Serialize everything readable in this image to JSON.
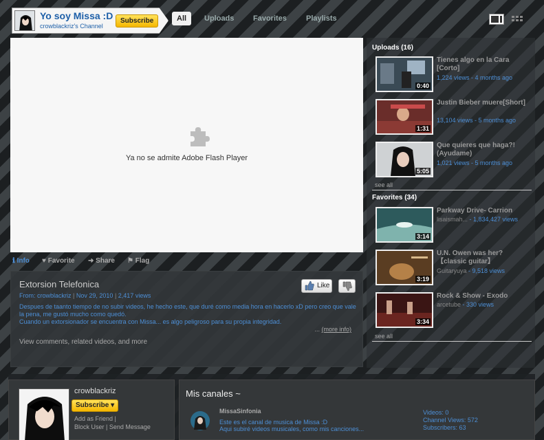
{
  "channel": {
    "title": "Yo soy Missa :D",
    "subtitle": "crowblackriz's Channel",
    "subscribe_label": "Subscribe"
  },
  "tabs": [
    {
      "label": "All",
      "active": true
    },
    {
      "label": "Uploads"
    },
    {
      "label": "Favorites"
    },
    {
      "label": "Playlists"
    }
  ],
  "player": {
    "message": "Ya no se admite Adobe Flash Player",
    "icon": "puzzle-icon"
  },
  "actions": [
    {
      "label": "Info",
      "icon": "info-icon",
      "active": true
    },
    {
      "label": "Favorite",
      "icon": "heart-icon"
    },
    {
      "label": "Share",
      "icon": "share-arrow-icon"
    },
    {
      "label": "Flag",
      "icon": "flag-icon"
    }
  ],
  "video": {
    "title": "Extorsion Telefonica",
    "from_label": "From:",
    "author": "crowblackriz",
    "date": "Nov 29, 2010",
    "views": "2,417 views",
    "description_lines": [
      "Despues de taanto tiempo de no subir videos, he hecho este, que duré como media hora en hacerlo xD pero creo que vale",
      "la pena, me gustó mucho como quedó.",
      "Cuando un extorsionador se encuentra con Missa... es algo peligroso para su propia integridad."
    ],
    "more_info": "(more info)",
    "ellipsis": "...",
    "view_comments": "View comments, related videos, and more",
    "like_label": "Like"
  },
  "uploads": {
    "heading": "Uploads (16)",
    "see_all": "see all",
    "items": [
      {
        "title": "Tienes algo en la Cara [Corto]",
        "duration": "0:40",
        "meta": "1,224 views - 4 months ago"
      },
      {
        "title": "Justin Bieber muere[Short]",
        "duration": "1:31",
        "meta": "13,104 views - 5 months ago"
      },
      {
        "title": "Que quieres que haga?! (Ayudame)",
        "duration": "5:05",
        "meta": "1,021 views - 5 months ago"
      }
    ]
  },
  "favorites": {
    "heading": "Favorites (34)",
    "see_all": "see all",
    "items": [
      {
        "title": "Parkway Drive- Carrion",
        "duration": "3:14",
        "author": "lisaismah...",
        "meta": " - 1,834,427 views"
      },
      {
        "title": "U.N. Owen was her? 【classic guitar】",
        "duration": "3:19",
        "author": "Guitaryuya",
        "meta": " - 9,518 views"
      },
      {
        "title": "Rock & Show - Exodo",
        "duration": "3:34",
        "author": "arcetube",
        "meta": " - 330 views"
      }
    ]
  },
  "profile": {
    "name": "crowblackriz",
    "subscribe_label": "Subscribe",
    "add_friend": "Add as Friend",
    "block_user": "Block User",
    "send_message": "Send Message"
  },
  "channels": {
    "title": "Mis canales ~",
    "featured": {
      "name": "MissaSinfonia",
      "desc_lines": [
        "Este es el canal de musica de Missa :D",
        "Aqui subiré videos musicales, como mis canciones..."
      ],
      "videos": "Videos: 0",
      "channel_views": "Channel Views: 572",
      "subscribers": "Subscribers: 63"
    }
  },
  "colors": {
    "accent": "#4d8fd6",
    "subscribe": "#f5b700",
    "background_dark": "#1c1f21",
    "background_stripe": "#3d4245"
  }
}
